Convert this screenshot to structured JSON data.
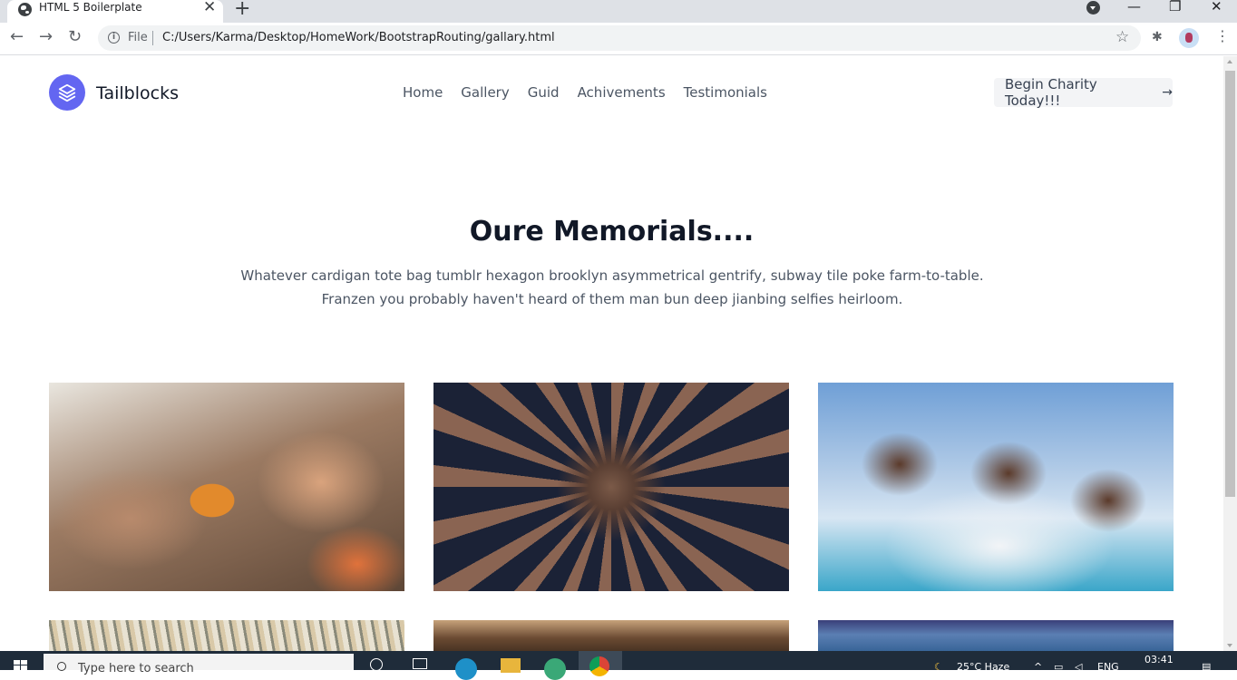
{
  "browser": {
    "tab_title": "HTML 5 Boilerplate",
    "new_tab": "+",
    "close_tab": "✕",
    "address": {
      "scheme_label": "File",
      "url": "C:/Users/Karma/Desktop/HomeWork/BootstrapRouting/gallary.html"
    },
    "window_controls": {
      "minimize": "—",
      "restore": "❐",
      "close": "✕"
    }
  },
  "site": {
    "brand": "Tailblocks",
    "nav": [
      "Home",
      "Gallery",
      "Guid",
      "Achivements",
      "Testimonials"
    ],
    "cta": {
      "label": "Begin Charity Today!!!",
      "arrow": "→"
    },
    "hero": {
      "title": "Oure Memorials....",
      "text": "Whatever cardigan tote bag tumblr hexagon brooklyn asymmetrical gentrify, subway tile poke farm-to-table. Franzen you probably haven't heard of them man bun deep jianbing selfies heirloom."
    },
    "gallery": [
      {
        "name": "gallery-image-children-hands"
      },
      {
        "name": "gallery-image-joined-hands"
      },
      {
        "name": "gallery-image-smiling-kids"
      },
      {
        "name": "gallery-image-crowd"
      },
      {
        "name": "gallery-image-village-group"
      },
      {
        "name": "gallery-image-women-group"
      }
    ]
  },
  "taskbar": {
    "search_placeholder": "Type here to search",
    "weather": "25°C  Haze",
    "language": "ENG",
    "time": "03:41"
  },
  "colors": {
    "brand_accent": "#6366f1",
    "taskbar": "#1f2c3a",
    "tabstrip": "#dee1e6"
  }
}
